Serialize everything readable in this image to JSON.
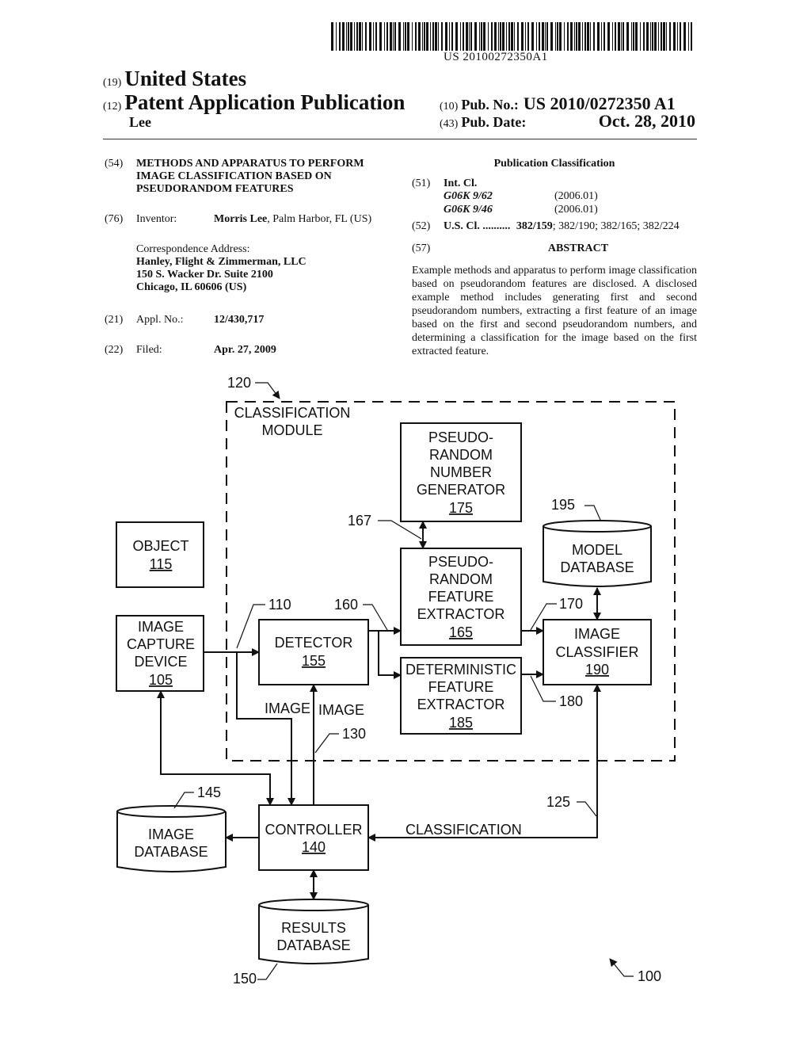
{
  "header": {
    "barcode_number": "US 20100272350A1",
    "country_code": "(19)",
    "country": "United States",
    "type_code": "(12)",
    "type": "Patent Application Publication",
    "inventor_surname": "Lee",
    "pub_no_code": "(10)",
    "pub_no_label": "Pub. No.:",
    "pub_no": "US 2010/0272350 A1",
    "pub_date_code": "(43)",
    "pub_date_label": "Pub. Date:",
    "pub_date": "Oct. 28, 2010"
  },
  "left": {
    "title_code": "(54)",
    "title_lines": [
      "METHODS AND APPARATUS TO PERFORM",
      "IMAGE CLASSIFICATION BASED ON",
      "PSEUDORANDOM FEATURES"
    ],
    "inventor_code": "(76)",
    "inventor_label": "Inventor:",
    "inventor_name": "Morris Lee",
    "inventor_location": ", Palm Harbor, FL (US)",
    "correspondence_label": "Correspondence Address:",
    "correspondence_lines": [
      "Hanley, Flight & Zimmerman, LLC",
      "150 S. Wacker Dr. Suite 2100",
      "Chicago, IL 60606 (US)"
    ],
    "appl_code": "(21)",
    "appl_label": "Appl. No.:",
    "appl_no": "12/430,717",
    "filed_code": "(22)",
    "filed_label": "Filed:",
    "filed_date": "Apr. 27, 2009"
  },
  "right": {
    "pub_class_heading": "Publication Classification",
    "int_cl_code": "(51)",
    "int_cl_label": "Int. Cl.",
    "int_cl": [
      {
        "code": "G06K 9/62",
        "version": "(2006.01)"
      },
      {
        "code": "G06K 9/46",
        "version": "(2006.01)"
      }
    ],
    "us_cl_code": "(52)",
    "us_cl_label": "U.S. Cl. ..........",
    "us_cl_primary": "382/159",
    "us_cl_rest": "; 382/190; 382/165; 382/224",
    "abstract_code": "(57)",
    "abstract_heading": "ABSTRACT",
    "abstract_text": "Example methods and apparatus to perform image classification based on pseudorandom features are disclosed. A disclosed example method includes generating first and second pseudorandom numbers, extracting a first feature of an image based on the first and second pseudorandom numbers, and determining a classification for the image based on the first extracted feature."
  },
  "diagram": {
    "module_ref": "120",
    "module_label": [
      "CLASSIFICATION",
      "MODULE"
    ],
    "object": {
      "label": "OBJECT",
      "ref": "115"
    },
    "capture": {
      "label": [
        "IMAGE",
        "CAPTURE",
        "DEVICE"
      ],
      "ref": "105"
    },
    "detector": {
      "label": "DETECTOR",
      "ref": "155"
    },
    "prng": {
      "label": [
        "PSEUDO-",
        "RANDOM",
        "NUMBER",
        "GENERATOR"
      ],
      "ref": "175"
    },
    "prfe": {
      "label": [
        "PSEUDO-",
        "RANDOM",
        "FEATURE",
        "EXTRACTOR"
      ],
      "ref": "165"
    },
    "dfe": {
      "label": [
        "DETERMINISTIC",
        "FEATURE",
        "EXTRACTOR"
      ],
      "ref": "185"
    },
    "classifier": {
      "label": [
        "IMAGE",
        "CLASSIFIER"
      ],
      "ref": "190"
    },
    "model_db": {
      "label": [
        "MODEL",
        "DATABASE"
      ],
      "ref": "195"
    },
    "controller": {
      "label": "CONTROLLER",
      "ref": "140"
    },
    "image_db": {
      "label": [
        "IMAGE",
        "DATABASE"
      ],
      "ref": "145"
    },
    "results_db": {
      "label": [
        "RESULTS",
        "DATABASE"
      ],
      "ref": "150"
    },
    "refs": {
      "r110": "110",
      "r160": "160",
      "r167": "167",
      "r170": "170",
      "r180": "180",
      "r130": "130",
      "r125": "125",
      "r100": "100"
    },
    "signal_image_1": "IMAGE",
    "signal_image_2": "IMAGE",
    "signal_classification": "CLASSIFICATION"
  }
}
